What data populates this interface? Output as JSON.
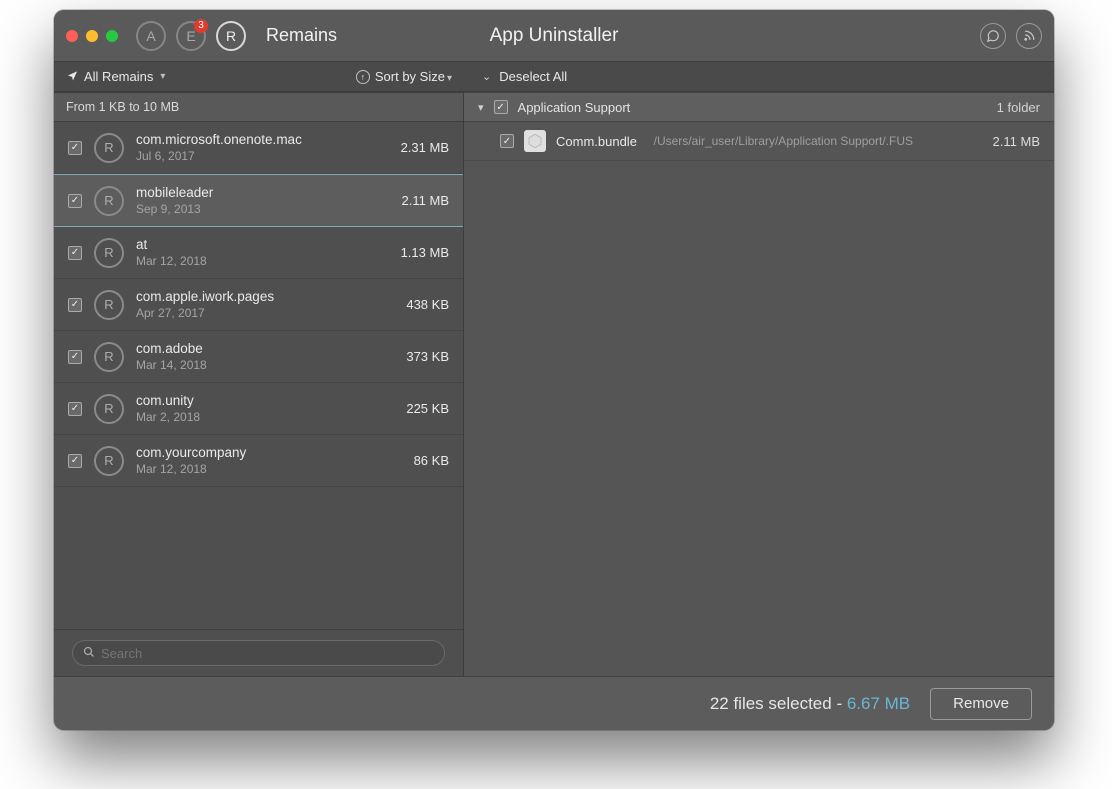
{
  "titlebar": {
    "badge_count": "3",
    "section_label": "Remains",
    "app_title": "App Uninstaller"
  },
  "toolbar": {
    "filter_label": "All Remains",
    "sort_label": "Sort by Size",
    "deselect_label": "Deselect All"
  },
  "left": {
    "range_label": "From 1 KB to 10 MB",
    "items": [
      {
        "name": "com.microsoft.onenote.mac",
        "date": "Jul 6, 2017",
        "size": "2.31 MB",
        "selected": false
      },
      {
        "name": "mobileleader",
        "date": "Sep 9, 2013",
        "size": "2.11 MB",
        "selected": true
      },
      {
        "name": "at",
        "date": "Mar 12, 2018",
        "size": "1.13 MB",
        "selected": false
      },
      {
        "name": "com.apple.iwork.pages",
        "date": "Apr 27, 2017",
        "size": "438 KB",
        "selected": false
      },
      {
        "name": "com.adobe",
        "date": "Mar 14, 2018",
        "size": "373 KB",
        "selected": false
      },
      {
        "name": "com.unity",
        "date": "Mar 2, 2018",
        "size": "225 KB",
        "selected": false
      },
      {
        "name": "com.yourcompany",
        "date": "Mar 12, 2018",
        "size": "86 KB",
        "selected": false
      }
    ],
    "search_placeholder": "Search"
  },
  "right": {
    "section_title": "Application Support",
    "section_count": "1 folder",
    "files": [
      {
        "name": "Comm.bundle",
        "path": "/Users/air_user/Library/Application Support/.FUS",
        "size": "2.11 MB"
      }
    ]
  },
  "footer": {
    "selected_text": "22 files selected",
    "separator": " - ",
    "total_size": "6.67 MB",
    "remove_label": "Remove"
  }
}
